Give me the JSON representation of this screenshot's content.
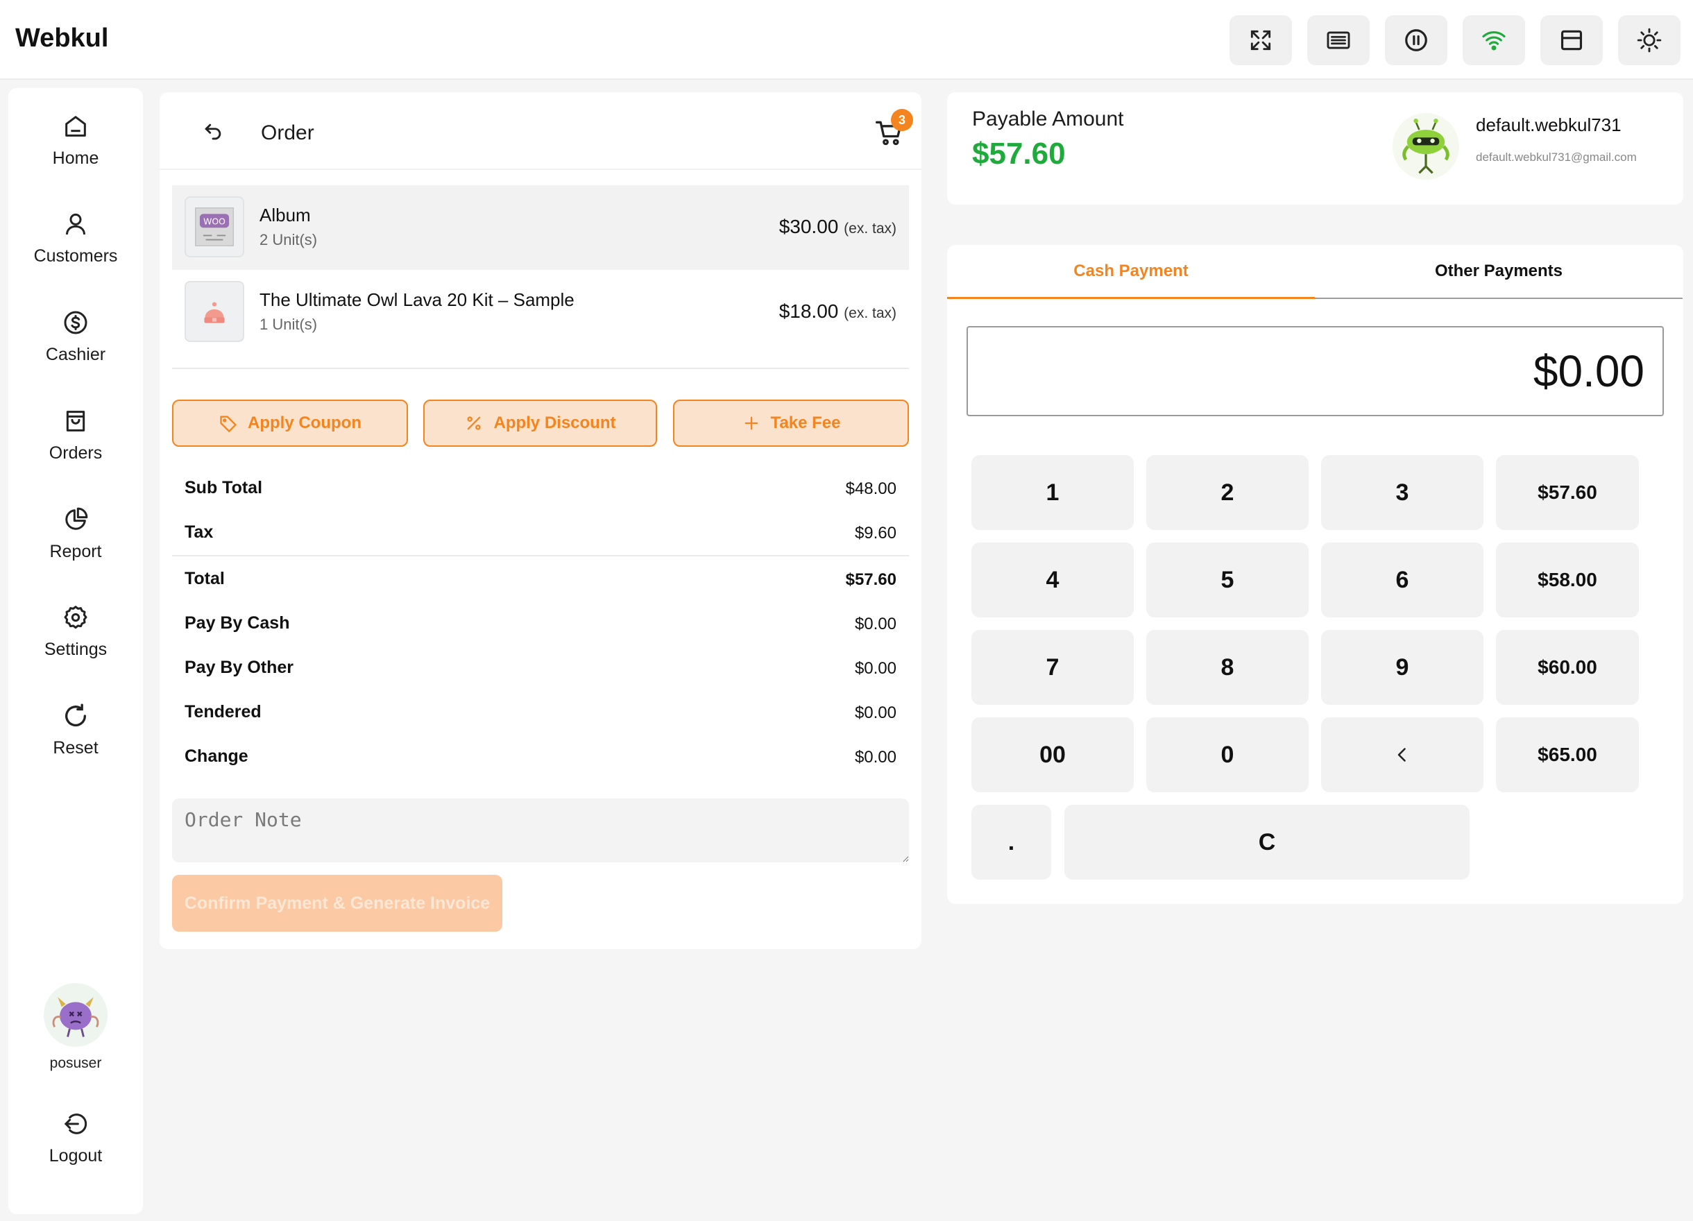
{
  "app": {
    "brand": "Webkul"
  },
  "topbar": {
    "icons": [
      "fullscreen-icon",
      "keyboard-icon",
      "pause-icon",
      "wifi-icon",
      "layout-icon",
      "sun-icon"
    ],
    "wifi_color": "#1fab3b"
  },
  "sidebar": {
    "items": [
      {
        "label": "Home",
        "icon": "home-icon"
      },
      {
        "label": "Customers",
        "icon": "user-icon"
      },
      {
        "label": "Cashier",
        "icon": "dollar-icon"
      },
      {
        "label": "Orders",
        "icon": "bag-icon"
      },
      {
        "label": "Report",
        "icon": "pie-chart-icon"
      },
      {
        "label": "Settings",
        "icon": "gear-icon"
      },
      {
        "label": "Reset",
        "icon": "reset-icon"
      }
    ],
    "user": {
      "name": "posuser"
    },
    "logout_label": "Logout"
  },
  "order": {
    "title": "Order",
    "cart_count": "3",
    "items": [
      {
        "name": "Album",
        "units": "2 Unit(s)",
        "price": "$30.00",
        "tax_note": "(ex. tax)"
      },
      {
        "name": "The Ultimate Owl Lava 20 Kit – Sample",
        "units": "1 Unit(s)",
        "price": "$18.00",
        "tax_note": "(ex. tax)"
      }
    ],
    "actions": {
      "coupon": "Apply Coupon",
      "discount": "Apply Discount",
      "fee": "Take Fee"
    },
    "summary": {
      "subtotal_label": "Sub Total",
      "subtotal": "$48.00",
      "tax_label": "Tax",
      "tax": "$9.60",
      "total_label": "Total",
      "total": "$57.60",
      "cash_label": "Pay By Cash",
      "cash": "$0.00",
      "other_label": "Pay By Other",
      "other": "$0.00",
      "tendered_label": "Tendered",
      "tendered": "$0.00",
      "change_label": "Change",
      "change": "$0.00"
    },
    "note_placeholder": "Order Note",
    "confirm_label": "Confirm Payment & Generate Invoice"
  },
  "payable": {
    "label": "Payable Amount",
    "amount": "$57.60",
    "customer_name": "default.webkul731",
    "customer_email": "default.webkul731@gmail.com"
  },
  "payment": {
    "tabs": {
      "cash": "Cash Payment",
      "other": "Other Payments"
    },
    "display": "$0.00",
    "keys": {
      "k1": "1",
      "k2": "2",
      "k3": "3",
      "k4": "4",
      "k5": "5",
      "k6": "6",
      "k7": "7",
      "k8": "8",
      "k9": "9",
      "k00": "00",
      "k0": "0",
      "dot": ".",
      "clear": "C"
    },
    "quick": [
      "$57.60",
      "$58.00",
      "$60.00",
      "$65.00"
    ]
  },
  "colors": {
    "accent": "#f3841e",
    "accent_light": "#fbe2cc",
    "success": "#1fab3b"
  }
}
